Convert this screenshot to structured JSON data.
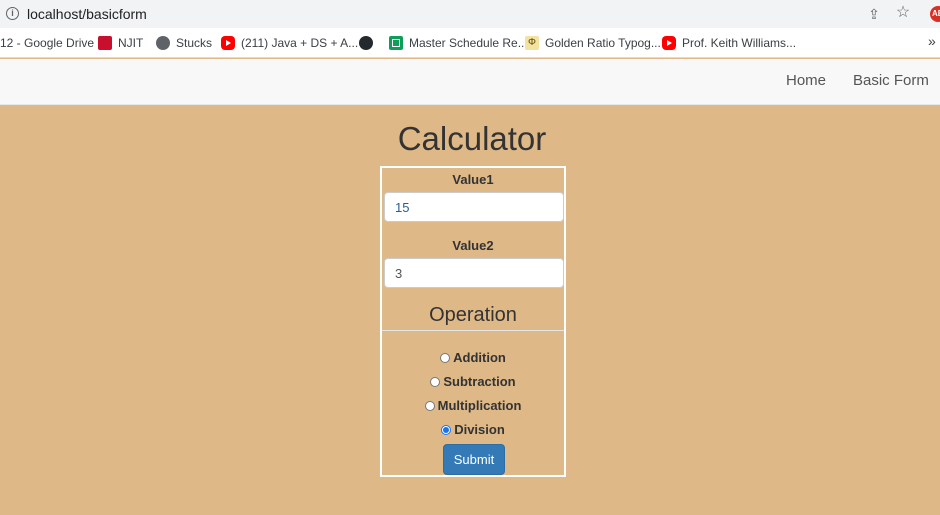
{
  "browser": {
    "url": "localhost/basicform",
    "avatar_text": "AB",
    "bookmarks": [
      {
        "label": "12 - Google Drive",
        "icon": "drive-icon"
      },
      {
        "label": "NJIT",
        "icon": "njit-icon"
      },
      {
        "label": "Stucks",
        "icon": "globe-icon"
      },
      {
        "label": "(211) Java + DS + A...",
        "icon": "youtube-icon"
      },
      {
        "label": "",
        "icon": "github-icon"
      },
      {
        "label": "Master Schedule Re...",
        "icon": "sheets-icon"
      },
      {
        "label": "Golden Ratio Typog...",
        "icon": "phi-icon"
      },
      {
        "label": "Prof. Keith Williams...",
        "icon": "youtube-icon"
      }
    ],
    "more_label": "»"
  },
  "nav": {
    "home": "Home",
    "basic_form": "Basic Form"
  },
  "calculator": {
    "title": "Calculator",
    "value1_label": "Value1",
    "value1": "15",
    "value2_label": "Value2",
    "value2": "3",
    "operation_legend": "Operation",
    "operations": [
      {
        "label": "Addition",
        "checked": false
      },
      {
        "label": "Subtraction",
        "checked": false
      },
      {
        "label": "Multiplication",
        "checked": false
      },
      {
        "label": "Division",
        "checked": true
      }
    ],
    "submit_label": "Submit"
  },
  "colors": {
    "page_background": "#deb887",
    "submit_button": "#337ab7"
  }
}
